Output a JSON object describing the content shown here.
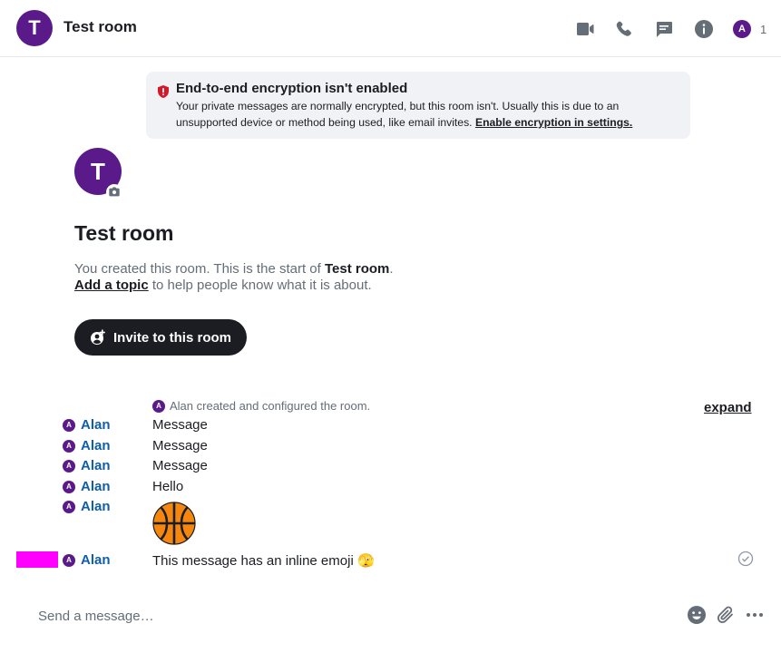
{
  "header": {
    "avatar_letter": "T",
    "title": "Test room",
    "member_avatar_letter": "A",
    "member_count": "1",
    "icon_color": "#656d77"
  },
  "banner": {
    "title": "End-to-end encryption isn't enabled",
    "text": "Your private messages are normally encrypted, but this room isn't. Usually this is due to an unsupported device or method being used, like email invites.",
    "link": "Enable encryption in settings.",
    "shield_color": "#d51928"
  },
  "intro": {
    "avatar_letter": "T",
    "title": "Test room",
    "created_prefix": "You created this room. This is the start of",
    "room_name": "Test room",
    "created_suffix": ".",
    "topic_link": "Add a topic",
    "topic_suffix": "to help people know what it is about.",
    "invite_button": "Invite to this room"
  },
  "timeline": {
    "summary_avatar": "A",
    "summary": "Alan created and configured the room.",
    "expand": "expand",
    "messages": [
      {
        "sender": "Alan",
        "avatar": "A",
        "body": "Message"
      },
      {
        "sender": "Alan",
        "avatar": "A",
        "body": "Message"
      },
      {
        "sender": "Alan",
        "avatar": "A",
        "body": "Message"
      },
      {
        "sender": "Alan",
        "avatar": "A",
        "body": "Hello"
      },
      {
        "sender": "Alan",
        "avatar": "A",
        "body": ""
      },
      {
        "sender": "Alan",
        "avatar": "A",
        "body": "This message has an inline emoji 🫣"
      }
    ],
    "sender_color": "#0f5ea8",
    "avatar_color": "#5a1a8a"
  },
  "composer": {
    "placeholder": "Send a message…"
  }
}
